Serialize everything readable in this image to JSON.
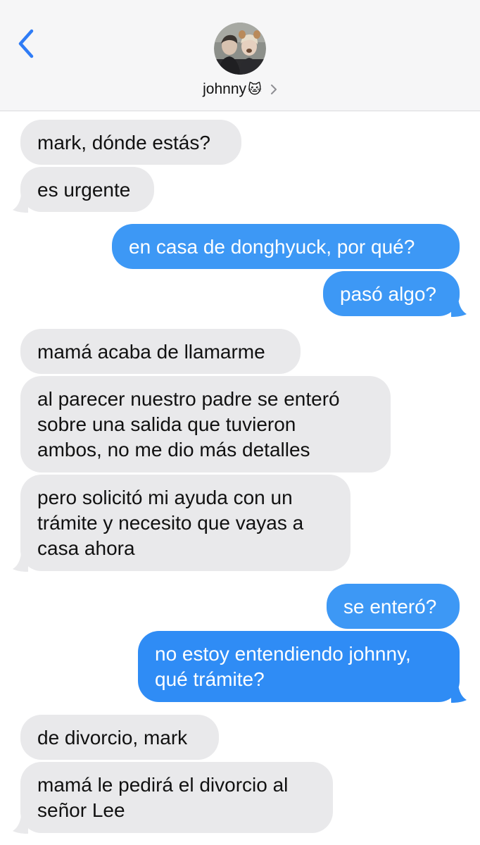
{
  "header": {
    "contact_name": "johnny",
    "contact_emoji": "🐱",
    "back_icon": "chevron-left-icon",
    "details_icon": "chevron-right-icon"
  },
  "colors": {
    "incoming_bubble": "#e9e9eb",
    "outgoing_bubble": "#2f8cf5",
    "accent": "#2f7cf6"
  },
  "messages": [
    {
      "sender": "johnny",
      "text": "mark, dónde estás?"
    },
    {
      "sender": "johnny",
      "text": "es urgente"
    },
    {
      "sender": "me",
      "text": "en casa de donghyuck, por qué?"
    },
    {
      "sender": "me",
      "text": "pasó algo?"
    },
    {
      "sender": "johnny",
      "text": "mamá acaba de llamarme"
    },
    {
      "sender": "johnny",
      "lines": [
        "al parecer nuestro padre se enteró",
        "sobre una salida que tuvieron",
        "ambos, no me dio más detalles"
      ]
    },
    {
      "sender": "johnny",
      "lines": [
        "pero solicitó mi ayuda con un",
        "trámite y necesito que vayas a",
        "casa ahora"
      ]
    },
    {
      "sender": "me",
      "text": "se enteró?"
    },
    {
      "sender": "me",
      "lines": [
        "no estoy entendiendo johnny,",
        "qué trámite?"
      ]
    },
    {
      "sender": "johnny",
      "text": "de divorcio, mark"
    },
    {
      "sender": "johnny",
      "lines": [
        "mamá le pedirá el divorcio al",
        "señor Lee"
      ]
    }
  ]
}
